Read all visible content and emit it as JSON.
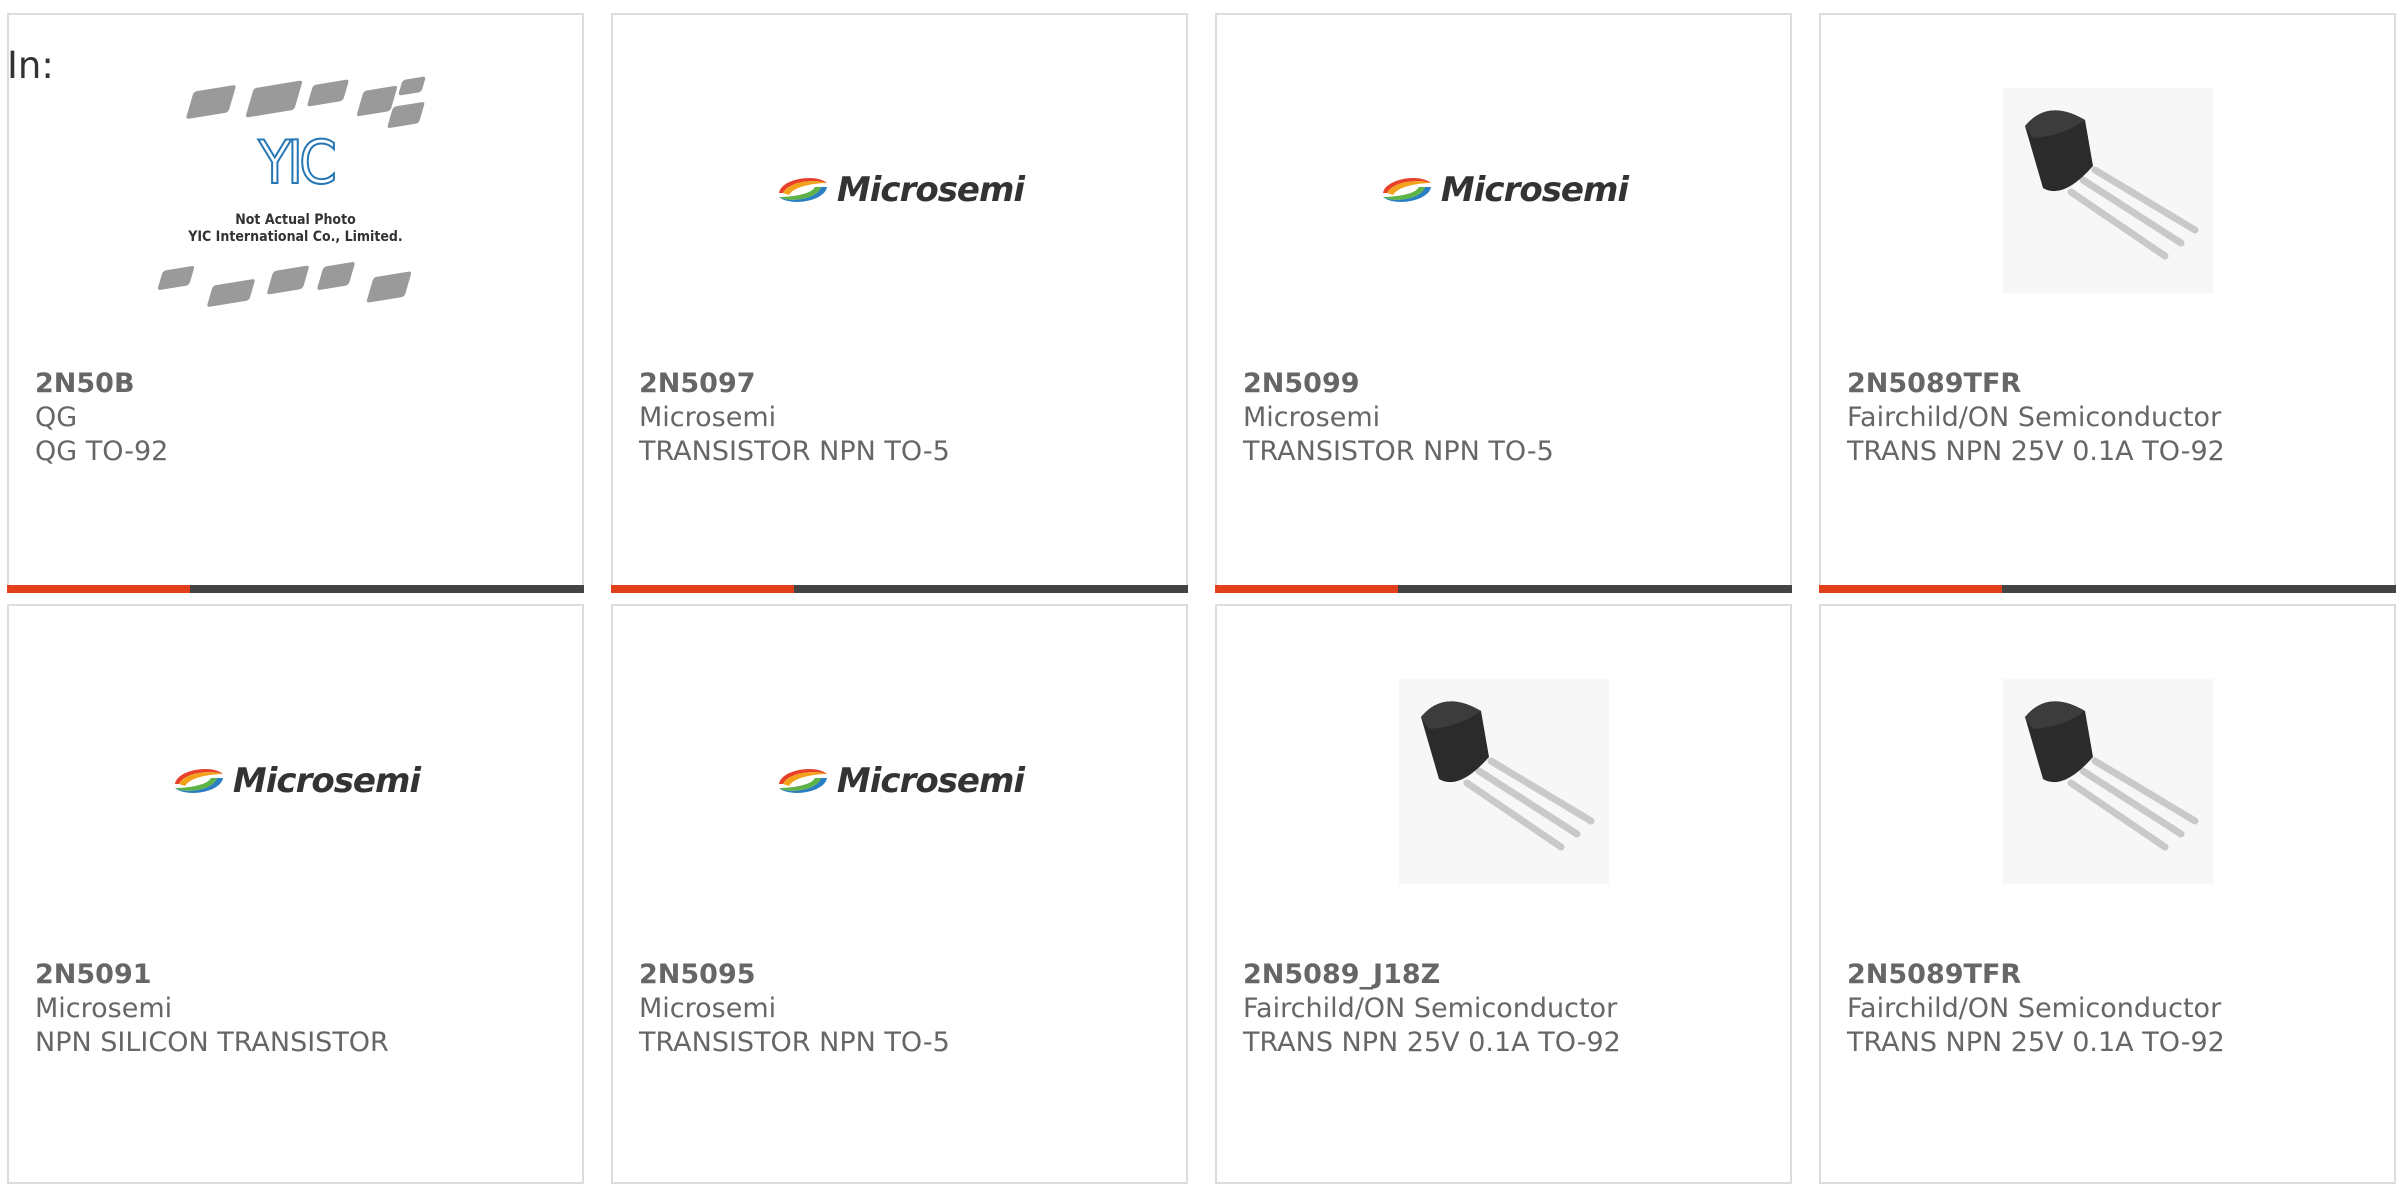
{
  "header": {
    "in_label": "In:"
  },
  "colors": {
    "accent": "#e2401b",
    "bar": "#444444",
    "border": "#dddddd",
    "text": "#666666"
  },
  "cards": [
    {
      "part": "2N50B",
      "manufacturer": "QG",
      "description": "QG TO-92",
      "image": "yic-placeholder",
      "image_text": [
        "Not Actual Photo",
        "YIC International Co., Limited."
      ],
      "logo_text": "YIC"
    },
    {
      "part": "2N5097",
      "manufacturer": "Microsemi",
      "description": "TRANSISTOR NPN TO-5",
      "image": "microsemi-logo",
      "logo_text": "Microsemi"
    },
    {
      "part": "2N5099",
      "manufacturer": "Microsemi",
      "description": "TRANSISTOR NPN TO-5",
      "image": "microsemi-logo",
      "logo_text": "Microsemi"
    },
    {
      "part": "2N5089TFR",
      "manufacturer": "Fairchild/ON Semiconductor",
      "description": "TRANS NPN 25V 0.1A TO-92",
      "image": "to92-transistor"
    },
    {
      "part": "2N5091",
      "manufacturer": "Microsemi",
      "description": "NPN SILICON TRANSISTOR",
      "image": "microsemi-logo",
      "logo_text": "Microsemi"
    },
    {
      "part": "2N5095",
      "manufacturer": "Microsemi",
      "description": "TRANSISTOR NPN TO-5",
      "image": "microsemi-logo",
      "logo_text": "Microsemi"
    },
    {
      "part": "2N5089_J18Z",
      "manufacturer": "Fairchild/ON Semiconductor",
      "description": "TRANS NPN 25V 0.1A TO-92",
      "image": "to92-transistor"
    },
    {
      "part": "2N5089TFR",
      "manufacturer": "Fairchild/ON Semiconductor",
      "description": "TRANS NPN 25V 0.1A TO-92",
      "image": "to92-transistor"
    }
  ]
}
